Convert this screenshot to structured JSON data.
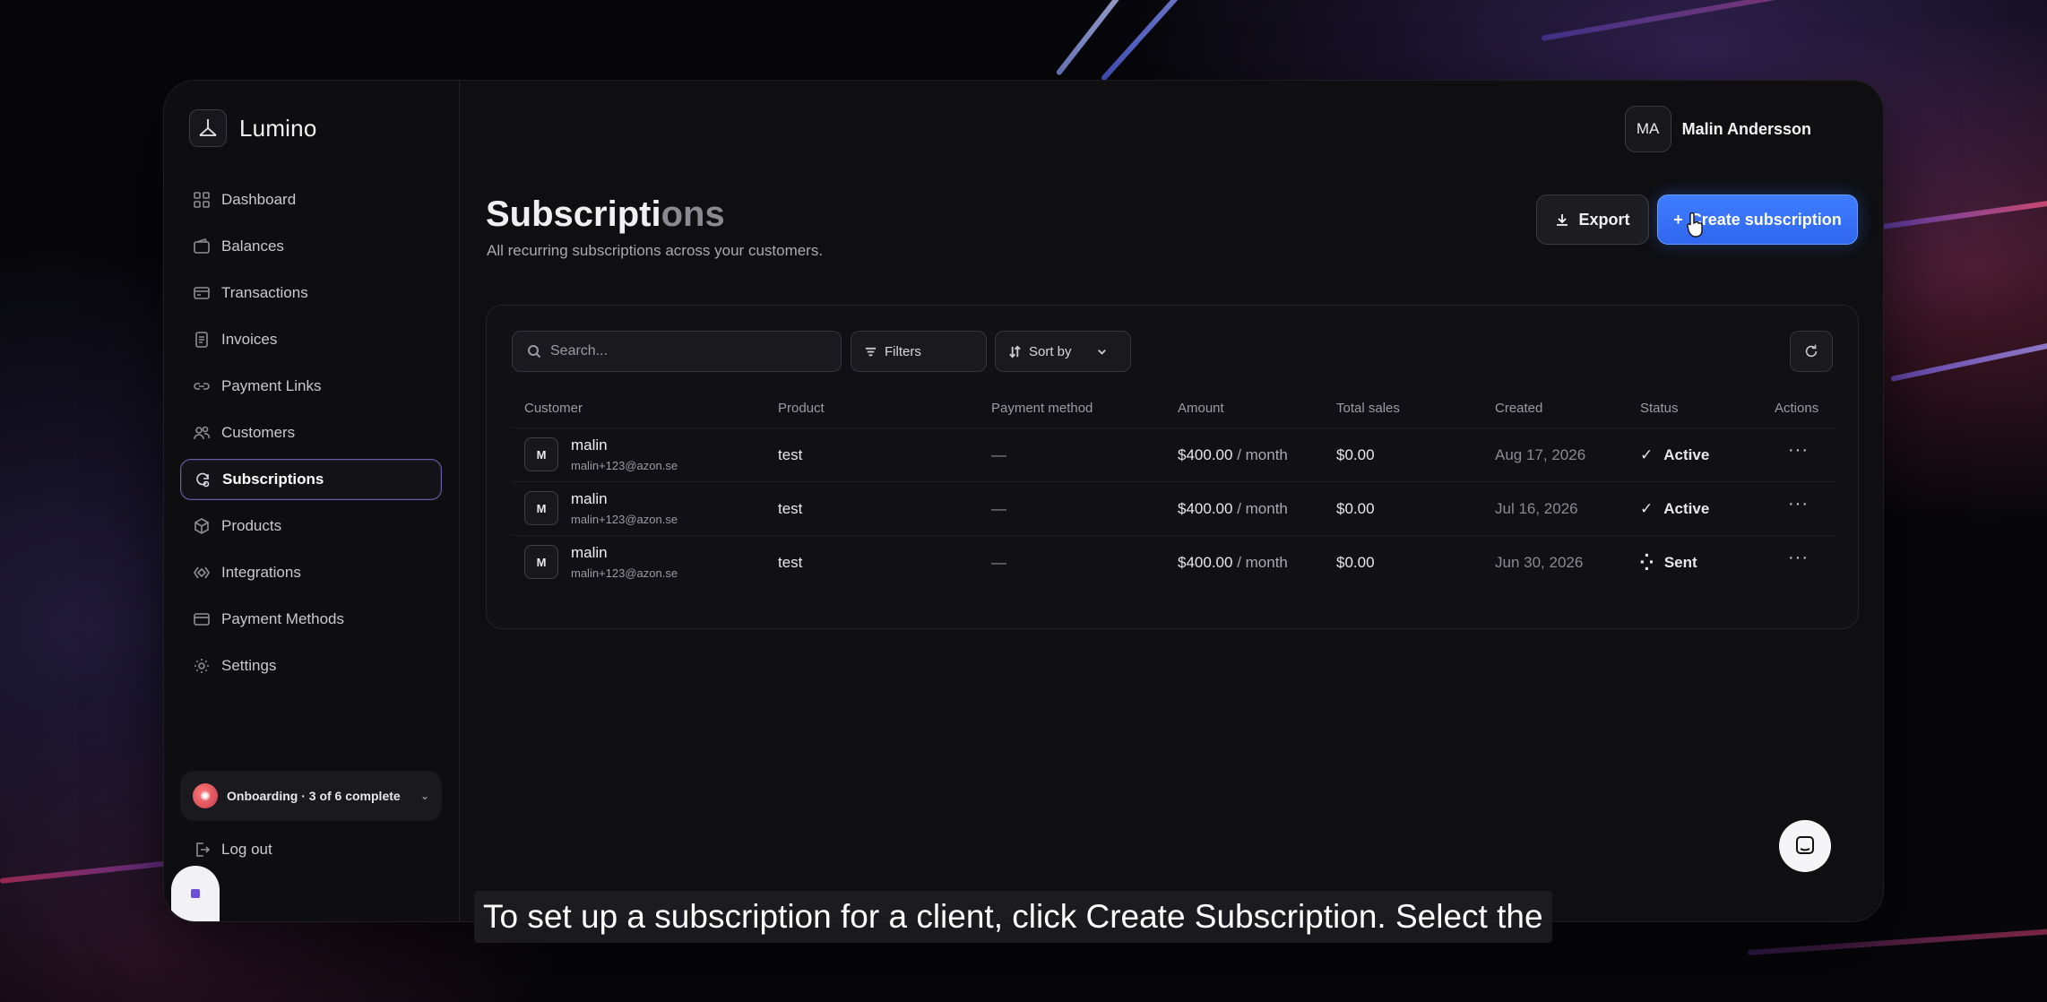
{
  "brand": {
    "name": "Lumino"
  },
  "sidebar": {
    "items": [
      {
        "label": "Dashboard",
        "icon": "grid-icon",
        "active": false
      },
      {
        "label": "Balances",
        "icon": "wallet-icon",
        "active": false
      },
      {
        "label": "Transactions",
        "icon": "card-icon",
        "active": false
      },
      {
        "label": "Invoices",
        "icon": "document-icon",
        "active": false
      },
      {
        "label": "Payment Links",
        "icon": "link-icon",
        "active": false
      },
      {
        "label": "Customers",
        "icon": "users-icon",
        "active": false
      },
      {
        "label": "Subscriptions",
        "icon": "subscriptions-icon",
        "active": true
      },
      {
        "label": "Products",
        "icon": "box-icon",
        "active": false
      },
      {
        "label": "Integrations",
        "icon": "integrations-icon",
        "active": false
      },
      {
        "label": "Payment Methods",
        "icon": "credit-card-icon",
        "active": false
      },
      {
        "label": "Settings",
        "icon": "gear-icon",
        "active": false
      }
    ],
    "onboarding": "Onboarding · 3 of 6 complete",
    "logout": "Log out"
  },
  "user": {
    "initials": "MA",
    "name": "Malin Andersson"
  },
  "page": {
    "title_main": "Subscripti",
    "title_fade": "ons",
    "subtitle": "All recurring subscriptions across your customers.",
    "export_label": "Export",
    "create_label": "Create subscription"
  },
  "toolbar": {
    "search_placeholder": "Search...",
    "filters_label": "Filters",
    "sort_label": "Sort by"
  },
  "table": {
    "columns": [
      "Customer",
      "Product",
      "Payment method",
      "Amount",
      "Total sales",
      "Created",
      "Status",
      "Actions"
    ],
    "rows": [
      {
        "initial": "M",
        "name": "malin",
        "email": "malin+123@azon.se",
        "product": "test",
        "payment_method": "—",
        "amount": "$400.00",
        "period": "/ month",
        "total_sales": "$0.00",
        "created": "Aug 17, 2026",
        "status": "Active",
        "status_icon": "check-icon"
      },
      {
        "initial": "M",
        "name": "malin",
        "email": "malin+123@azon.se",
        "product": "test",
        "payment_method": "—",
        "amount": "$400.00",
        "period": "/ month",
        "total_sales": "$0.00",
        "created": "Jul 16, 2026",
        "status": "Active",
        "status_icon": "check-icon"
      },
      {
        "initial": "M",
        "name": "malin",
        "email": "malin+123@azon.se",
        "product": "test",
        "payment_method": "—",
        "amount": "$400.00",
        "period": "/ month",
        "total_sales": "$0.00",
        "created": "Jun 30, 2026",
        "status": "Sent",
        "status_icon": "spinner-icon"
      }
    ]
  },
  "caption": "To set up a subscription for a client, click Create Subscription. Select the",
  "colors": {
    "accent": "#3f7cff",
    "active_border": "#6b5ca8",
    "background": "#0f0f12"
  }
}
